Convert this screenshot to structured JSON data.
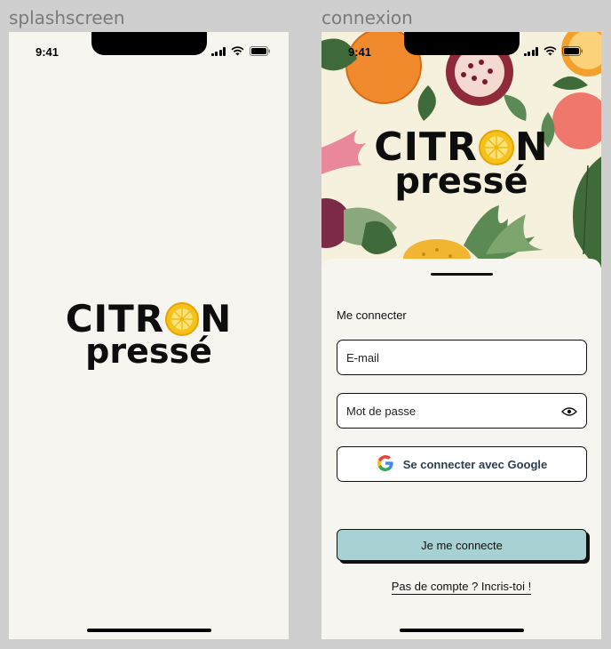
{
  "frames": {
    "splash_label": "splashscreen",
    "login_label": "connexion"
  },
  "status_bar": {
    "time": "9:41"
  },
  "logo": {
    "top_left": "CITR",
    "top_right": "N",
    "bottom": "pressé"
  },
  "login": {
    "title": "Me connecter",
    "email_placeholder": "E-mail",
    "password_placeholder": "Mot de passe",
    "google_label": "Se connecter avec Google",
    "submit_label": "Je me connecte",
    "signup_link": "Pas de compte ? Incris-toi !"
  },
  "colors": {
    "background": "#f7f5f0",
    "primary_button": "#a8d1d3",
    "lemon": "#f4c21a"
  },
  "icons": {
    "signal": "cellular-signal-icon",
    "wifi": "wifi-icon",
    "battery": "battery-icon",
    "eye": "eye-icon",
    "google": "google-logo-icon"
  }
}
